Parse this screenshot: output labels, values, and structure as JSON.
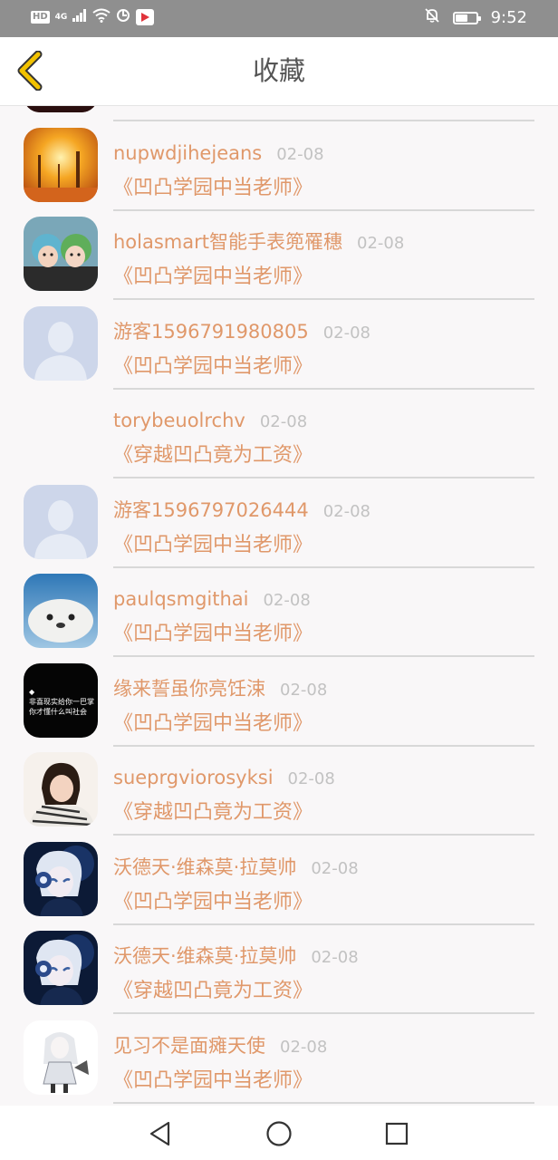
{
  "status_bar": {
    "hd": "HD",
    "network": "4G",
    "time": "9:52",
    "battery_level": 0.6,
    "icons": [
      "signal-icon",
      "wifi-icon",
      "data-saver-icon",
      "app-notification-icon",
      "mute-bell-icon",
      "battery-icon"
    ]
  },
  "header": {
    "title": "收藏",
    "back_icon": "chevron-left-icon",
    "accent": "#f2c200"
  },
  "colors": {
    "name": "#e0986a",
    "date": "#c2c2c2",
    "divider": "#d8d8d8",
    "background": "#f9f7f8"
  },
  "items": [
    {
      "username": "",
      "date": "",
      "title": "",
      "avatar": "dark-red-photo"
    },
    {
      "username": "nupwdjihejeans",
      "date": "02-08",
      "title": "《凹凸学园中当老师》",
      "avatar": "autumn-forest-photo"
    },
    {
      "username": "holasmart智能手表篼罹穗",
      "date": "02-08",
      "title": "《凹凸学园中当老师》",
      "avatar": "couple-photo"
    },
    {
      "username": "游客1596791980805",
      "date": "02-08",
      "title": "《凹凸学园中当老师》",
      "avatar": "default-user-silhouette"
    },
    {
      "username": "torybeuolrchv",
      "date": "02-08",
      "title": "《穿越凹凸竟为工资》",
      "avatar": "none"
    },
    {
      "username": "游客1596797026444",
      "date": "02-08",
      "title": "《凹凸学园中当老师》",
      "avatar": "default-user-silhouette"
    },
    {
      "username": "paulqsmgithai",
      "date": "02-08",
      "title": "《凹凸学园中当老师》",
      "avatar": "seal-photo"
    },
    {
      "username": "缘来誓虽你亮饪涑",
      "date": "02-08",
      "title": "《凹凸学园中当老师》",
      "avatar": "black-text-image",
      "avatar_text": [
        "◆",
        "非喜现实给你一巴掌",
        "你才懂什么叫社会"
      ]
    },
    {
      "username": "sueprgviorosyksi",
      "date": "02-08",
      "title": "《穿越凹凸竟为工资》",
      "avatar": "girl-photo"
    },
    {
      "username": "沃德天·维森莫·拉莫帅",
      "date": "02-08",
      "title": "《凹凸学园中当老师》",
      "avatar": "anime-boy-headphones"
    },
    {
      "username": "沃德天·维森莫·拉莫帅",
      "date": "02-08",
      "title": "《穿越凹凸竟为工资》",
      "avatar": "anime-boy-headphones"
    },
    {
      "username": "见习不是面瘫天使",
      "date": "02-08",
      "title": "《凹凸学园中当老师》",
      "avatar": "anime-white-girl"
    }
  ],
  "nav": {
    "icons": [
      "back-triangle-icon",
      "home-circle-icon",
      "recents-square-icon"
    ]
  }
}
